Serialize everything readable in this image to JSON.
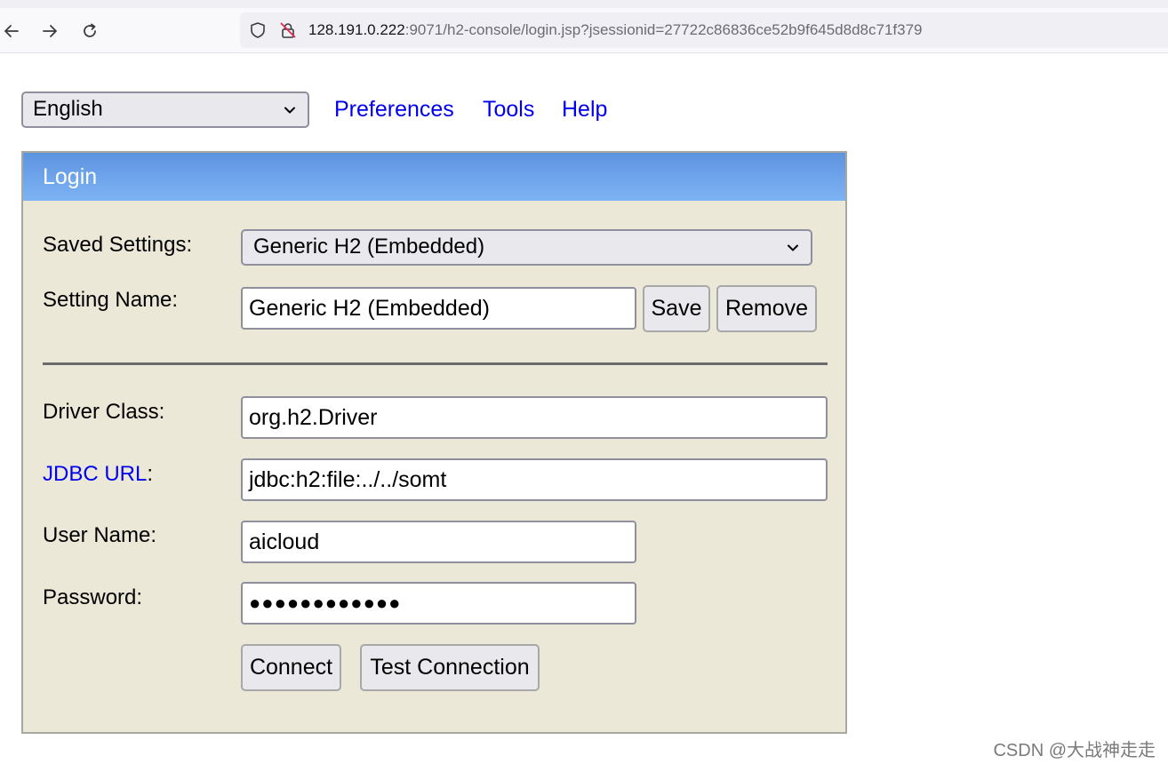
{
  "browser": {
    "url_host": "128.191.0.222",
    "url_rest": ":9071/h2-console/login.jsp?jsessionid=27722c86836ce52b9f645d8d8c71f379"
  },
  "top_bar": {
    "language": "English",
    "links": [
      "Preferences",
      "Tools",
      "Help"
    ]
  },
  "login": {
    "title": "Login",
    "saved_settings_label": "Saved Settings:",
    "saved_settings_value": "Generic H2 (Embedded)",
    "setting_name_label": "Setting Name:",
    "setting_name_value": "Generic H2 (Embedded)",
    "save_label": "Save",
    "remove_label": "Remove",
    "driver_class_label": "Driver Class:",
    "driver_class_value": "org.h2.Driver",
    "jdbc_url_link": "JDBC URL",
    "jdbc_url_colon": ":",
    "jdbc_url_value": "jdbc:h2:file:../../somt",
    "user_name_label": "User Name:",
    "user_name_value": "aicloud",
    "password_label": "Password:",
    "password_value": "●●●●●●●●●●●●",
    "connect_label": "Connect",
    "test_connection_label": "Test Connection"
  },
  "watermark": "CSDN @大战神走走",
  "colors": {
    "link": "#0000ee",
    "panel_bg": "#ece8d8",
    "header_top": "#5e93df",
    "header_bottom": "#7db4f4"
  }
}
